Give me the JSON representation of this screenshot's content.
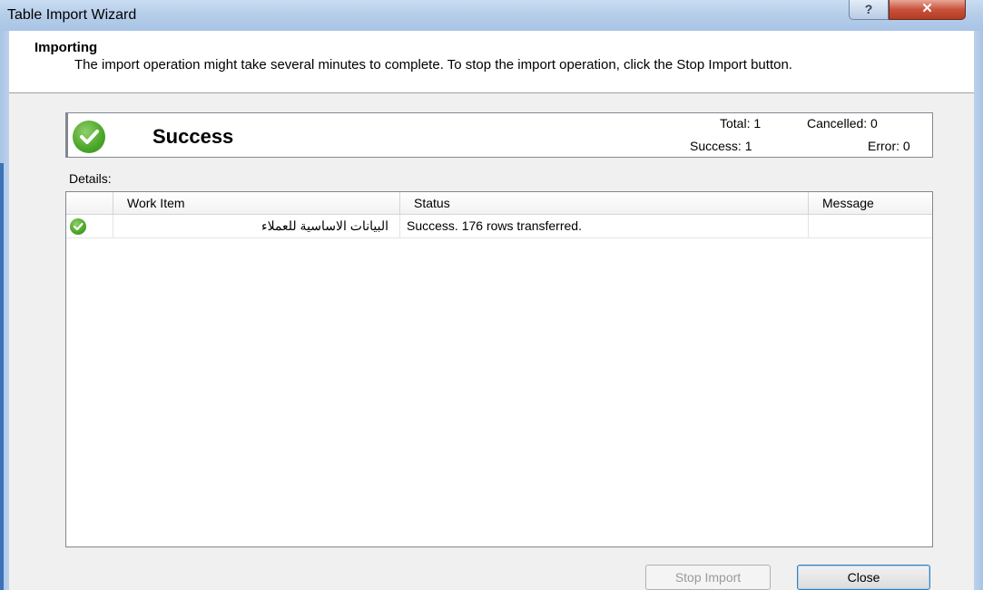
{
  "window": {
    "title": "Table Import Wizard",
    "help_glyph": "?",
    "close_glyph": "✕"
  },
  "header": {
    "title": "Importing",
    "description": "The import operation might take several minutes to complete. To stop the import operation, click the Stop Import button."
  },
  "summary": {
    "status_icon": "success-check-icon",
    "status": "Success",
    "total_label": "Total: 1",
    "cancelled_label": "Cancelled: 0",
    "success_label": "Success: 1",
    "error_label": "Error: 0"
  },
  "details": {
    "label": "Details:",
    "columns": [
      "Work Item",
      "Status",
      "Message"
    ],
    "rows": [
      {
        "icon": "success-check-icon",
        "work_item": "البيانات الاساسية للعملاء",
        "status": "Success. 176 rows transferred.",
        "message": ""
      }
    ]
  },
  "buttons": {
    "stop_import": "Stop Import",
    "close": "Close"
  },
  "colors": {
    "success_green": "#4aa528",
    "title_bar": "#b5cde9",
    "close_red": "#c8523c"
  }
}
